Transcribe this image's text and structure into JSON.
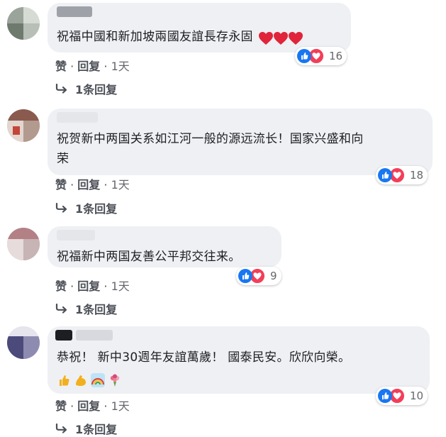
{
  "comments": [
    {
      "text": "祝福中國和新加坡兩國友誼長存永固",
      "emoji_suffix": [
        "red-heart",
        "red-heart",
        "red-heart"
      ],
      "reaction_count": "16",
      "actions": {
        "like": "赞",
        "reply": "回复",
        "time": "1天"
      },
      "replies_label": "1条回复"
    },
    {
      "text_line1": "祝贺新中两国关系如江河一般的源远流长！国家兴盛和向",
      "text_line2": "荣",
      "reaction_count": "18",
      "actions": {
        "like": "赞",
        "reply": "回复",
        "time": "1天"
      },
      "replies_label": "1条回复"
    },
    {
      "text": "祝福新中两国友善公平邦交往来。",
      "reaction_count": "9",
      "actions": {
        "like": "赞",
        "reply": "回复",
        "time": "1天"
      },
      "replies_label": "1条回复"
    },
    {
      "text": "恭祝！ 新中30週年友誼萬歲！ 國泰民安。欣欣向榮。",
      "emoji_row": [
        "thumbs-up",
        "flexed-biceps",
        "rainbow",
        "bouquet"
      ],
      "reaction_count": "10",
      "actions": {
        "like": "赞",
        "reply": "回复",
        "time": "1天"
      },
      "replies_label": "1条回复"
    }
  ],
  "colors": {
    "bubble": "#eef0f3",
    "like": "#1877f2",
    "love": "#f33e58",
    "meta_text": "#4b4f56"
  }
}
